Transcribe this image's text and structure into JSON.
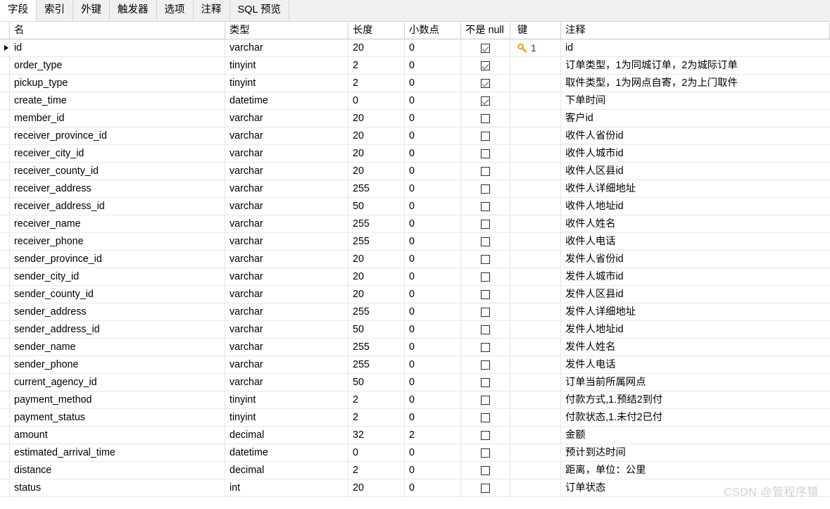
{
  "tabs": [
    {
      "label": "字段",
      "active": true
    },
    {
      "label": "索引",
      "active": false
    },
    {
      "label": "外键",
      "active": false
    },
    {
      "label": "触发器",
      "active": false
    },
    {
      "label": "选项",
      "active": false
    },
    {
      "label": "注释",
      "active": false
    },
    {
      "label": "SQL 预览",
      "active": false
    }
  ],
  "columns": {
    "name": "名",
    "type": "类型",
    "length": "长度",
    "decimals": "小数点",
    "not_null": "不是 null",
    "key": "键",
    "comment": "注释"
  },
  "rows": [
    {
      "selected": true,
      "name": "id",
      "type": "varchar",
      "length": "20",
      "decimals": "0",
      "not_null": true,
      "key": "1",
      "comment": "id"
    },
    {
      "selected": false,
      "name": "order_type",
      "type": "tinyint",
      "length": "2",
      "decimals": "0",
      "not_null": true,
      "key": "",
      "comment": "订单类型，1为同城订单，2为城际订单"
    },
    {
      "selected": false,
      "name": "pickup_type",
      "type": "tinyint",
      "length": "2",
      "decimals": "0",
      "not_null": true,
      "key": "",
      "comment": "取件类型，1为网点自寄，2为上门取件"
    },
    {
      "selected": false,
      "name": "create_time",
      "type": "datetime",
      "length": "0",
      "decimals": "0",
      "not_null": true,
      "key": "",
      "comment": "下单时间"
    },
    {
      "selected": false,
      "name": "member_id",
      "type": "varchar",
      "length": "20",
      "decimals": "0",
      "not_null": false,
      "key": "",
      "comment": "客户id"
    },
    {
      "selected": false,
      "name": "receiver_province_id",
      "type": "varchar",
      "length": "20",
      "decimals": "0",
      "not_null": false,
      "key": "",
      "comment": "收件人省份id"
    },
    {
      "selected": false,
      "name": "receiver_city_id",
      "type": "varchar",
      "length": "20",
      "decimals": "0",
      "not_null": false,
      "key": "",
      "comment": "收件人城市id"
    },
    {
      "selected": false,
      "name": "receiver_county_id",
      "type": "varchar",
      "length": "20",
      "decimals": "0",
      "not_null": false,
      "key": "",
      "comment": "收件人区县id"
    },
    {
      "selected": false,
      "name": "receiver_address",
      "type": "varchar",
      "length": "255",
      "decimals": "0",
      "not_null": false,
      "key": "",
      "comment": "收件人详细地址"
    },
    {
      "selected": false,
      "name": "receiver_address_id",
      "type": "varchar",
      "length": "50",
      "decimals": "0",
      "not_null": false,
      "key": "",
      "comment": "收件人地址id"
    },
    {
      "selected": false,
      "name": "receiver_name",
      "type": "varchar",
      "length": "255",
      "decimals": "0",
      "not_null": false,
      "key": "",
      "comment": "收件人姓名"
    },
    {
      "selected": false,
      "name": "receiver_phone",
      "type": "varchar",
      "length": "255",
      "decimals": "0",
      "not_null": false,
      "key": "",
      "comment": "收件人电话"
    },
    {
      "selected": false,
      "name": "sender_province_id",
      "type": "varchar",
      "length": "20",
      "decimals": "0",
      "not_null": false,
      "key": "",
      "comment": "发件人省份id"
    },
    {
      "selected": false,
      "name": "sender_city_id",
      "type": "varchar",
      "length": "20",
      "decimals": "0",
      "not_null": false,
      "key": "",
      "comment": "发件人城市id"
    },
    {
      "selected": false,
      "name": "sender_county_id",
      "type": "varchar",
      "length": "20",
      "decimals": "0",
      "not_null": false,
      "key": "",
      "comment": "发件人区县id"
    },
    {
      "selected": false,
      "name": "sender_address",
      "type": "varchar",
      "length": "255",
      "decimals": "0",
      "not_null": false,
      "key": "",
      "comment": "发件人详细地址"
    },
    {
      "selected": false,
      "name": "sender_address_id",
      "type": "varchar",
      "length": "50",
      "decimals": "0",
      "not_null": false,
      "key": "",
      "comment": "发件人地址id"
    },
    {
      "selected": false,
      "name": "sender_name",
      "type": "varchar",
      "length": "255",
      "decimals": "0",
      "not_null": false,
      "key": "",
      "comment": "发件人姓名"
    },
    {
      "selected": false,
      "name": "sender_phone",
      "type": "varchar",
      "length": "255",
      "decimals": "0",
      "not_null": false,
      "key": "",
      "comment": "发件人电话"
    },
    {
      "selected": false,
      "name": "current_agency_id",
      "type": "varchar",
      "length": "50",
      "decimals": "0",
      "not_null": false,
      "key": "",
      "comment": "订单当前所属网点"
    },
    {
      "selected": false,
      "name": "payment_method",
      "type": "tinyint",
      "length": "2",
      "decimals": "0",
      "not_null": false,
      "key": "",
      "comment": "付款方式,1.预结2到付"
    },
    {
      "selected": false,
      "name": "payment_status",
      "type": "tinyint",
      "length": "2",
      "decimals": "0",
      "not_null": false,
      "key": "",
      "comment": "付款状态,1.未付2已付"
    },
    {
      "selected": false,
      "name": "amount",
      "type": "decimal",
      "length": "32",
      "decimals": "2",
      "not_null": false,
      "key": "",
      "comment": "金额"
    },
    {
      "selected": false,
      "name": "estimated_arrival_time",
      "type": "datetime",
      "length": "0",
      "decimals": "0",
      "not_null": false,
      "key": "",
      "comment": "预计到达时间"
    },
    {
      "selected": false,
      "name": "distance",
      "type": "decimal",
      "length": "2",
      "decimals": "0",
      "not_null": false,
      "key": "",
      "comment": "距离，单位：公里"
    },
    {
      "selected": false,
      "name": "status",
      "type": "int",
      "length": "20",
      "decimals": "0",
      "not_null": false,
      "key": "",
      "comment": "订单状态"
    }
  ],
  "watermark": "CSDN @管程序猿",
  "colors": {
    "key_icon": "#e8a617",
    "key_number": "#1f3864",
    "tab_active_bg": "#ffffff",
    "tab_inactive_bg": "#f0f0f0",
    "grid_line": "#e6e6e6"
  }
}
